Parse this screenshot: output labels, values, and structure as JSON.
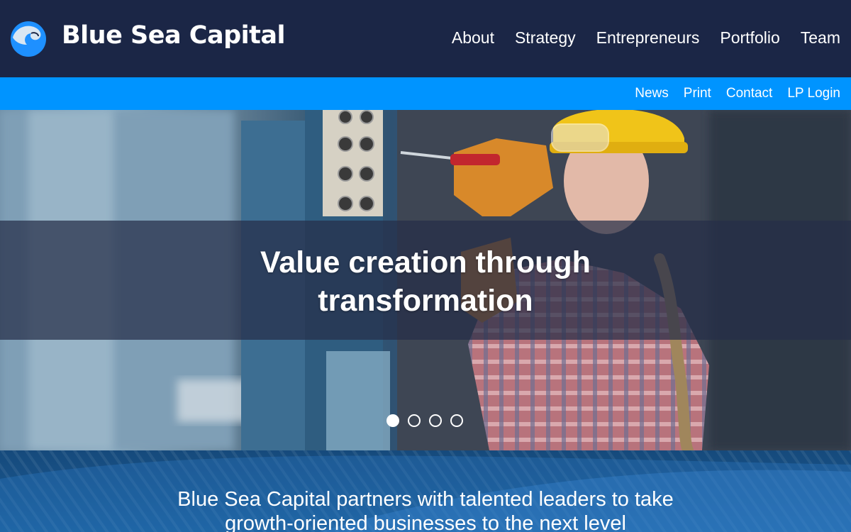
{
  "brand": {
    "name": "Blue Sea Capital",
    "logo_icon": "wave-logo-icon"
  },
  "main_nav": [
    "About",
    "Strategy",
    "Entrepreneurs",
    "Portfolio",
    "Team"
  ],
  "sub_nav": [
    "News",
    "Print",
    "Contact",
    "LP Login"
  ],
  "hero": {
    "title_line1": "Value creation through",
    "title_line2": "transformation",
    "slide_count": 4,
    "active_slide": 1
  },
  "tagline": {
    "line1": "Blue Sea Capital partners with talented leaders to take",
    "line2": "growth-oriented businesses to the next level"
  },
  "colors": {
    "header_bg": "#1b2646",
    "subnav_bg": "#0094ff",
    "accent_blue": "#0094ff",
    "text": "#ffffff"
  }
}
